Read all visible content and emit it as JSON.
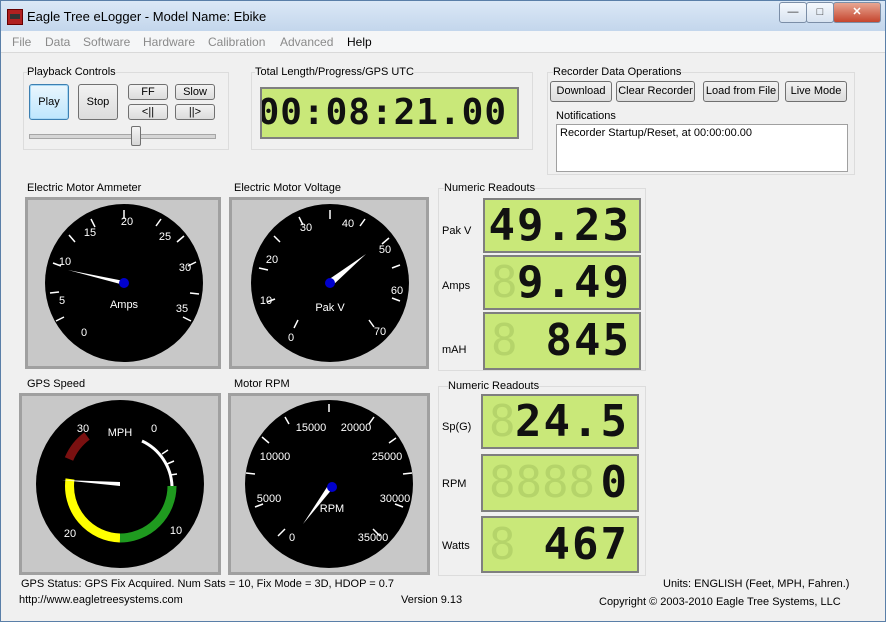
{
  "window": {
    "title": "Eagle Tree eLogger - Model Name: Ebike",
    "minimize": "—",
    "maximize": "□",
    "close": "✕"
  },
  "menu": [
    "File",
    "Data",
    "Software",
    "Hardware",
    "Calibration",
    "Advanced",
    "Help"
  ],
  "playback": {
    "label": "Playback Controls",
    "play": "Play",
    "stop": "Stop",
    "ff": "FF",
    "slow": "Slow",
    "back": "<||",
    "fwd": "||>",
    "position": 0.58
  },
  "progress": {
    "label": "Total Length/Progress/GPS UTC",
    "value": "00:08:21.00"
  },
  "recorder": {
    "label": "Recorder Data Operations",
    "download": "Download",
    "clear": "Clear Recorder",
    "load": "Load from File",
    "live": "Live Mode"
  },
  "notifications": {
    "label": "Notifications",
    "text": "Recorder Startup/Reset, at 00:00:00.00"
  },
  "ammeter": {
    "label": "Electric Motor Ammeter",
    "unit": "Amps",
    "ticks": [
      "0",
      "5",
      "10",
      "15",
      "20",
      "25",
      "30",
      "35"
    ],
    "value": 9.49
  },
  "voltage": {
    "label": "Electric Motor Voltage",
    "unit": "Pak V",
    "ticks": [
      "0",
      "10",
      "20",
      "30",
      "40",
      "50",
      "60",
      "70"
    ],
    "value": 49.23
  },
  "readouts1": {
    "label": "Numeric Readouts",
    "items": [
      {
        "name": "Pak V",
        "value": "49.23"
      },
      {
        "name": "Amps",
        "value": "9.49"
      },
      {
        "name": "mAH",
        "value": "845"
      }
    ]
  },
  "gps": {
    "label": "GPS Speed",
    "unit": "MPH",
    "ticks": [
      "30",
      "0",
      "10",
      "20"
    ],
    "value": 24.5
  },
  "rpm": {
    "label": "Motor RPM",
    "unit": "RPM",
    "ticks": [
      "0",
      "5000",
      "10000",
      "15000",
      "20000",
      "25000",
      "30000",
      "35000"
    ],
    "value": 0
  },
  "readouts2": {
    "label": "Numeric Readouts",
    "items": [
      {
        "name": "Sp(G)",
        "value": "24.5"
      },
      {
        "name": "RPM",
        "value": "0"
      },
      {
        "name": "Watts",
        "value": "467"
      }
    ]
  },
  "status": {
    "gps": "GPS Status:  GPS Fix Acquired.  Num Sats = 10, Fix Mode = 3D, HDOP = 0.7",
    "units": "Units: ENGLISH (Feet, MPH, Fahren.)",
    "url": "http://www.eagletreesystems.com",
    "version": "Version 9.13",
    "copyright": "Copyright © 2003-2010 Eagle Tree Systems, LLC"
  }
}
